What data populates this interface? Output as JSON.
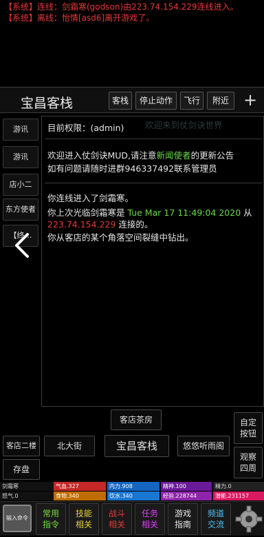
{
  "system_log": [
    "【系统】连线：剑霜寒(godson)由223.74.154.229连线进入。",
    "【系统】离线：怡情[asd6]离开游戏了。"
  ],
  "room": {
    "title": "宝昌客栈",
    "buttons": [
      "客栈",
      "停止动作",
      "飞行",
      "附近"
    ],
    "plus": "+"
  },
  "sidebar": {
    "items": [
      "游讯",
      "游讯",
      "店小二",
      "东方使者",
      "【终…"
    ]
  },
  "messages": {
    "permission": "目前权限：(admin)",
    "faded": "欢迎来到仗剑诀世界",
    "welcome_pre": "欢迎进入仗剑诀MUD,请注意",
    "welcome_highlight": "新闻使者",
    "welcome_post": "的更新公告",
    "contact": "如有问题请随时进群946337492联系管理员",
    "connected": "你连线进入了剑霜寒。",
    "last_login_pre": "你上次光临剑霜寒是 ",
    "last_login_time": "Tue Mar 17 11:49:04 2020",
    "last_login_mid": " 从",
    "last_login_ip": "223.74.154.229",
    "last_login_post": " 连接的。",
    "arrival": "你从客店的某个角落空间裂缝中钻出。"
  },
  "exits": {
    "north": "客店茶房",
    "west": "北大街",
    "center": "宝昌客栈",
    "east": "悠悠听雨阁",
    "left_top": "客店二楼",
    "left_bottom": "存盘",
    "custom": "自定\n按钮",
    "observe": "观察\n四周"
  },
  "stats": {
    "name": "剑霜寒",
    "hp": "气血.327",
    "neili": "内力.908",
    "jingshen": "精神.100",
    "jingli": "精力.0",
    "nuqi": "怒气.0",
    "food": "食物.340",
    "water": "饮水.340",
    "exp": "经验.228744",
    "potential": "潜能.231157"
  },
  "toolbar": {
    "input": "输入命令",
    "items": [
      {
        "l1": "常用",
        "l2": "指令",
        "color": "#7ddc3a"
      },
      {
        "l1": "技能",
        "l2": "相关",
        "color": "#e6d43a"
      },
      {
        "l1": "战斗",
        "l2": "相关",
        "color": "#e53935"
      },
      {
        "l1": "任务",
        "l2": "相关",
        "color": "#e040fb"
      },
      {
        "l1": "游戏",
        "l2": "指南",
        "color": "#e6e6e6"
      },
      {
        "l1": "频道",
        "l2": "交流",
        "color": "#4fc3f7"
      }
    ]
  },
  "colors": {
    "hp_bar": "#c62828",
    "neili_bar": "#1565c0",
    "jingshen_bar": "#6a1b9a",
    "food_bar": "#bf6d00",
    "water_bar": "#1976d2",
    "exp_bar": "#8e24aa",
    "potential_bar": "#d81b60"
  }
}
